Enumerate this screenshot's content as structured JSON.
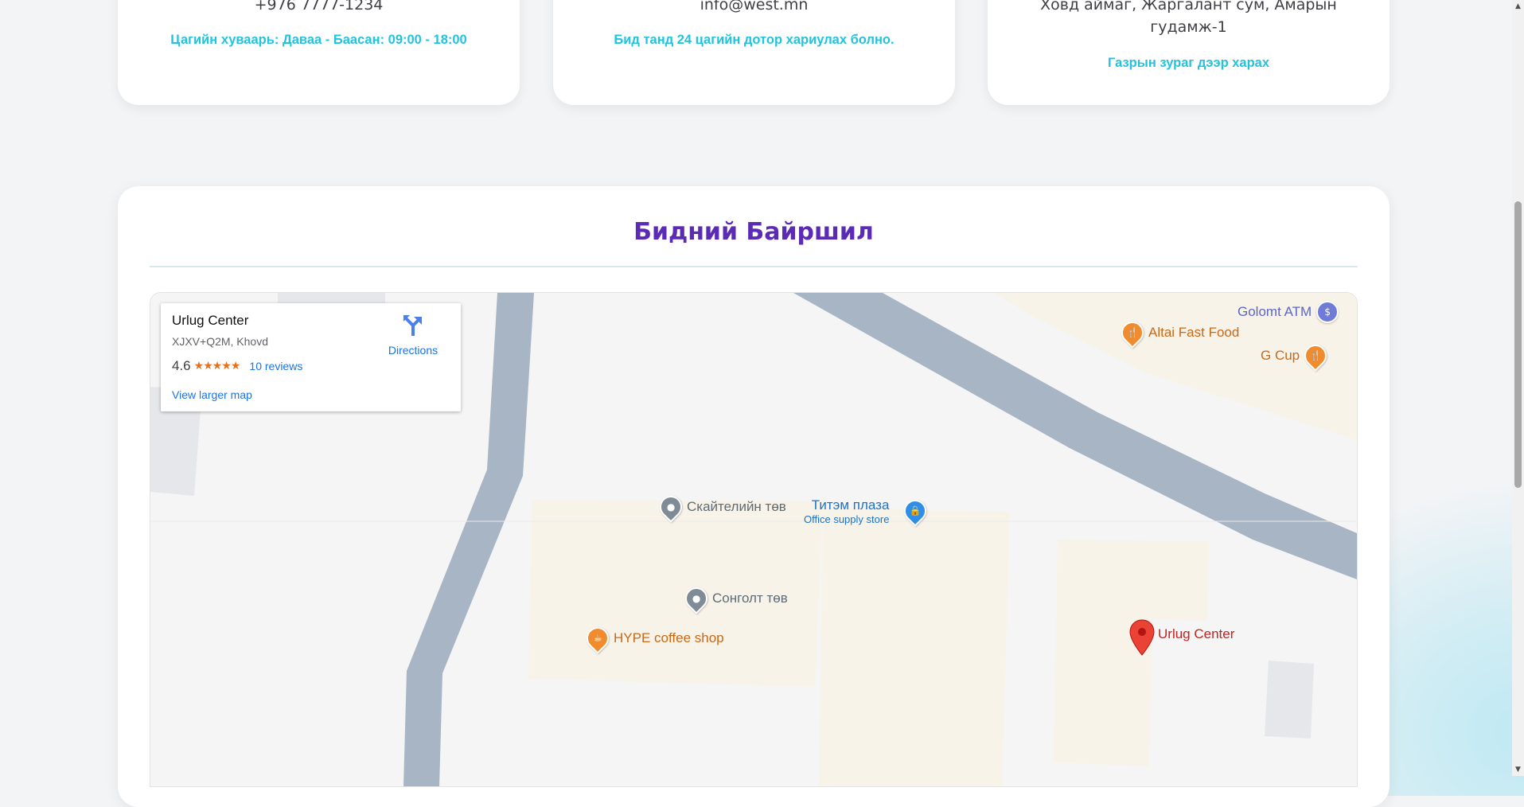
{
  "contact_cards": {
    "phone": {
      "value": "+976 7777-1234",
      "note": "Цагийн хуваарь: Даваа - Баасан: 09:00 - 18:00"
    },
    "email": {
      "value": "info@west.mn",
      "note": "Бид танд 24 цагийн дотор хариулах болно."
    },
    "address": {
      "value": "Ховд аймаг, Жаргалант сум, Амарын гудамж-1",
      "note": "Газрын зураг дээр харах"
    }
  },
  "location_section": {
    "title": "Бидний Байршил"
  },
  "map": {
    "info_window": {
      "place_name": "Urlug Center",
      "address": "XJXV+Q2M, Khovd",
      "rating": "4.6",
      "stars": "★★★★★",
      "reviews": "10 reviews",
      "view_larger": "View larger map",
      "directions": "Directions"
    },
    "pois": {
      "golomt_atm": "Golomt ATM",
      "altai_fast_food": "Altai Fast Food",
      "g_cup": "G Cup",
      "skating_center": "Скайтелийн төв",
      "titem_plaza": "Титэм плаза",
      "titem_plaza_sub": "Office supply store",
      "songolt_center": "Сонголт төв",
      "hype_coffee": "HYPE coffee shop",
      "urlug_center": "Urlug Center"
    },
    "colors": {
      "road": "#a7b5c5",
      "block": "#f8f3e8",
      "building": "#e6e7eb",
      "background": "#f5f5f5"
    }
  }
}
